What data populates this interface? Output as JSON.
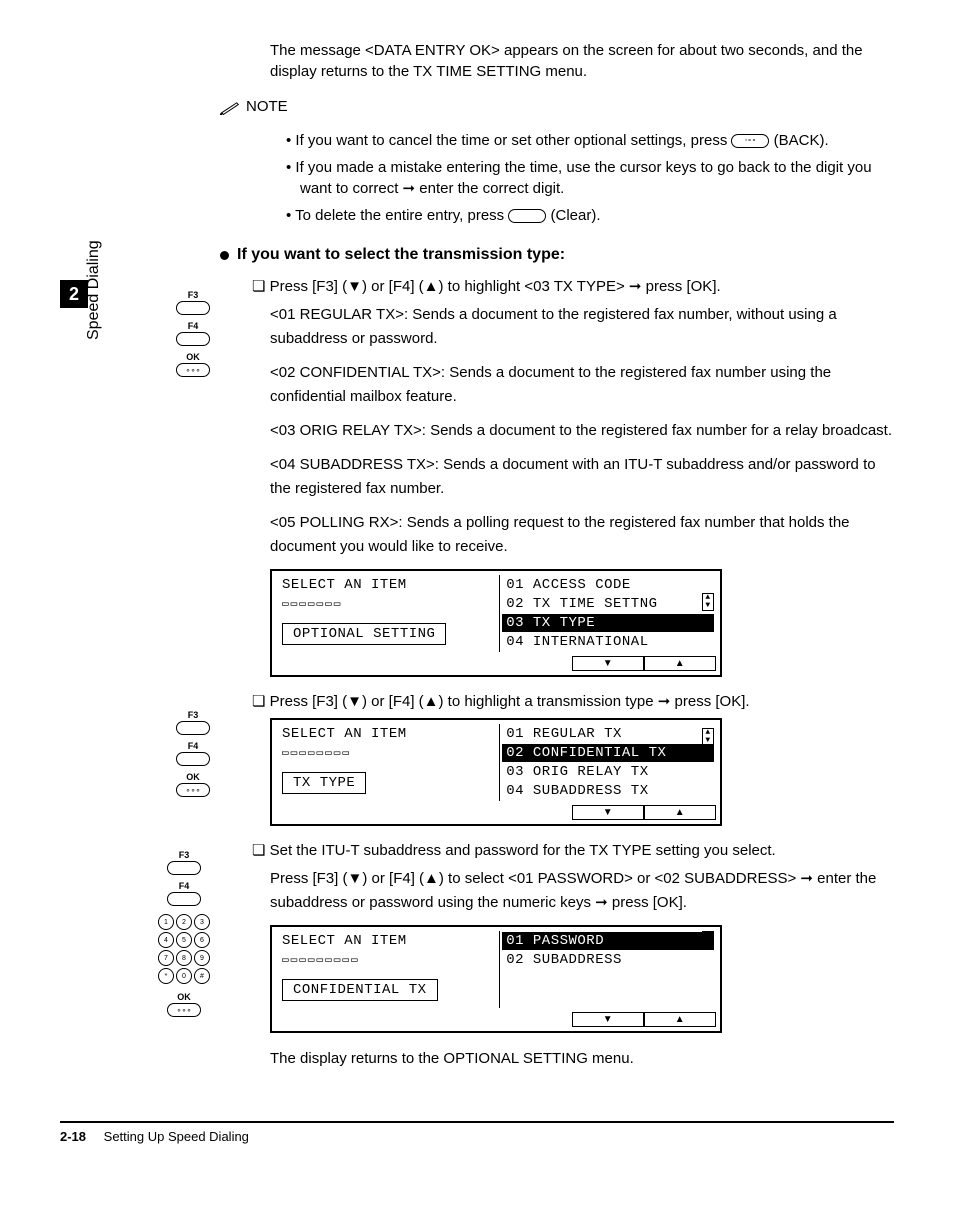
{
  "intro": "The message <DATA ENTRY OK> appears on the screen for about two seconds, and the display returns to the TX TIME SETTING menu.",
  "note_label": "NOTE",
  "notes": {
    "n1a": "If you want to cancel the time or set other optional settings, press ",
    "n1b": " (BACK).",
    "n2": "If you made a mistake entering the time, use the cursor keys to go back to the digit you want to correct ➞ enter the correct digit.",
    "n3a": "To delete the entire entry, press ",
    "n3b": " (Clear)."
  },
  "section_title": "If you want to select the transmission type:",
  "steps": {
    "s1": "Press [F3] (▼) or [F4] (▲) to highlight <03 TX TYPE> ➞ press [OK].",
    "s1_sub1": "<01 REGULAR TX>: Sends a document to the registered fax number, without using a subaddress or password.",
    "s1_sub2": "<02 CONFIDENTIAL TX>: Sends a document to the registered fax number using the confidential mailbox feature.",
    "s1_sub3": "<03 ORIG RELAY TX>: Sends a document to the registered fax number for a relay broadcast.",
    "s1_sub4": "<04 SUBADDRESS TX>: Sends a document with an ITU-T subaddress and/or password to the registered fax number.",
    "s1_sub5": "<05 POLLING RX>: Sends a polling request to the registered fax number that holds the document you would like to receive.",
    "s2": "Press [F3] (▼) or [F4] (▲) to highlight a transmission type ➞ press [OK].",
    "s3": "Set the ITU-T subaddress and password for the TX TYPE setting you select.",
    "s3_sub": "Press [F3] (▼) or [F4] (▲) to select <01 PASSWORD> or <02 SUBADDRESS> ➞ enter the subaddress or password using the numeric keys ➞ press [OK].",
    "s3_end": "The display returns to the OPTIONAL SETTING menu."
  },
  "lcd1": {
    "title": "SELECT AN ITEM",
    "box": "OPTIONAL SETTING",
    "r1": "01 ACCESS CODE",
    "r2": "02 TX TIME SETTNG",
    "r3": "03 TX TYPE",
    "r4": "04 INTERNATIONAL"
  },
  "lcd2": {
    "title": "SELECT AN ITEM",
    "box": "TX TYPE",
    "r1": "01 REGULAR TX",
    "r2": "02 CONFIDENTIAL TX",
    "r3": "03 ORIG RELAY TX",
    "r4": "04 SUBADDRESS TX"
  },
  "lcd3": {
    "title": "SELECT AN ITEM",
    "box": "CONFIDENTIAL TX",
    "r1": "01 PASSWORD",
    "r2": "02 SUBADDRESS"
  },
  "keys": {
    "f3": "F3",
    "f4": "F4",
    "ok": "OK"
  },
  "chapter": "2",
  "side_label": "Speed Dialing",
  "footer_page": "2-18",
  "footer_title": "Setting Up Speed Dialing"
}
